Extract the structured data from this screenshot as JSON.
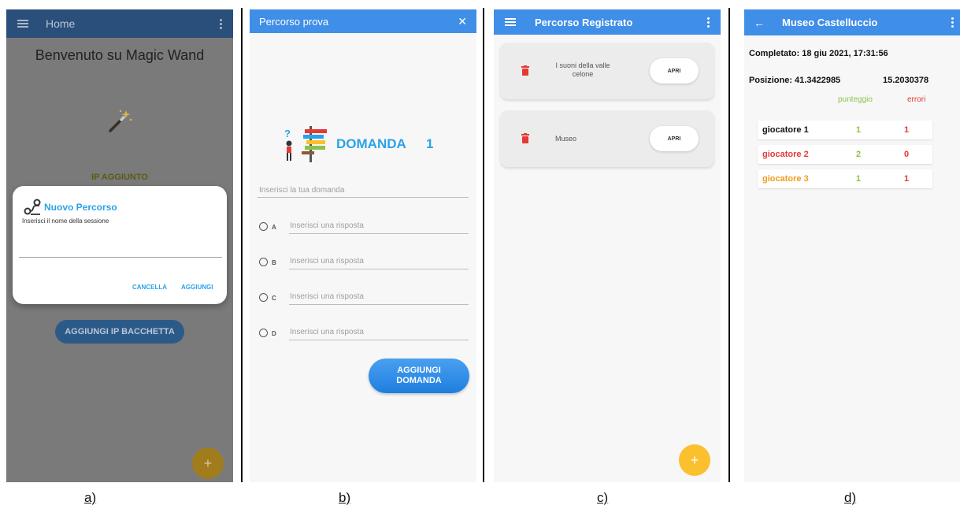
{
  "screen_a": {
    "title": "Home",
    "welcome": "Benvenuto su Magic Wand",
    "ip_added": "IP AGGIUNTO",
    "add_ip_button": "AGGIUNGI IP BACCHETTA",
    "fab": "+",
    "dialog": {
      "title": "Nuovo Percorso",
      "message": "Inserisci il nome della sessione",
      "cancel": "CANCELLA",
      "add": "AGGIUNGI"
    }
  },
  "screen_b": {
    "title": "Percorso prova",
    "close": "✕",
    "question_label": "DOMANDA",
    "question_number": "1",
    "question_placeholder": "Inserisci la tua domanda",
    "options": [
      {
        "letter": "A",
        "placeholder": "Inserisci una risposta"
      },
      {
        "letter": "B",
        "placeholder": "Inserisci una risposta"
      },
      {
        "letter": "C",
        "placeholder": "Inserisci una risposta"
      },
      {
        "letter": "D",
        "placeholder": "Inserisci una risposta"
      }
    ],
    "add_question_line1": "AGGIUNGI",
    "add_question_line2": "DOMANDA"
  },
  "screen_c": {
    "title": "Percorso Registrato",
    "items": [
      {
        "name_line1": "I suoni della valle",
        "name_line2": "celone",
        "open": "APRI"
      },
      {
        "name_line1": "Museo",
        "name_line2": "",
        "open": "APRI"
      }
    ],
    "fab": "+"
  },
  "screen_d": {
    "title": "Museo Castelluccio",
    "completed": "Completato: 18 giu 2021, 17:31:56",
    "position_label": "Posizione: 41.3422985",
    "position_lon": "15.2030378",
    "col_score": "punteggio",
    "col_errors": "errori",
    "players": [
      {
        "name": "giocatore 1",
        "score": "1",
        "errors": "1"
      },
      {
        "name": "giocatore 2",
        "score": "2",
        "errors": "0"
      },
      {
        "name": "giocatore 3",
        "score": "1",
        "errors": "1"
      }
    ]
  },
  "captions": {
    "a": "a)",
    "b": "b)",
    "c": "c)",
    "d": "d)"
  },
  "colors": {
    "appbar_blue": "#3f8ee8",
    "appbar_dim": "#2a4f7a",
    "accent_text": "#29a3e8",
    "button_blue": "#1e7ee0",
    "fab_yellow": "#fbc02d",
    "score_green": "#8bc34a",
    "error_red": "#e53935",
    "player_orange": "#f29a1a"
  },
  "icons": [
    "menu-icon",
    "more-vert-icon",
    "magic-wand-icon",
    "route-icon",
    "signpost-icon",
    "close-icon",
    "trash-icon",
    "back-arrow-icon",
    "plus-icon"
  ]
}
